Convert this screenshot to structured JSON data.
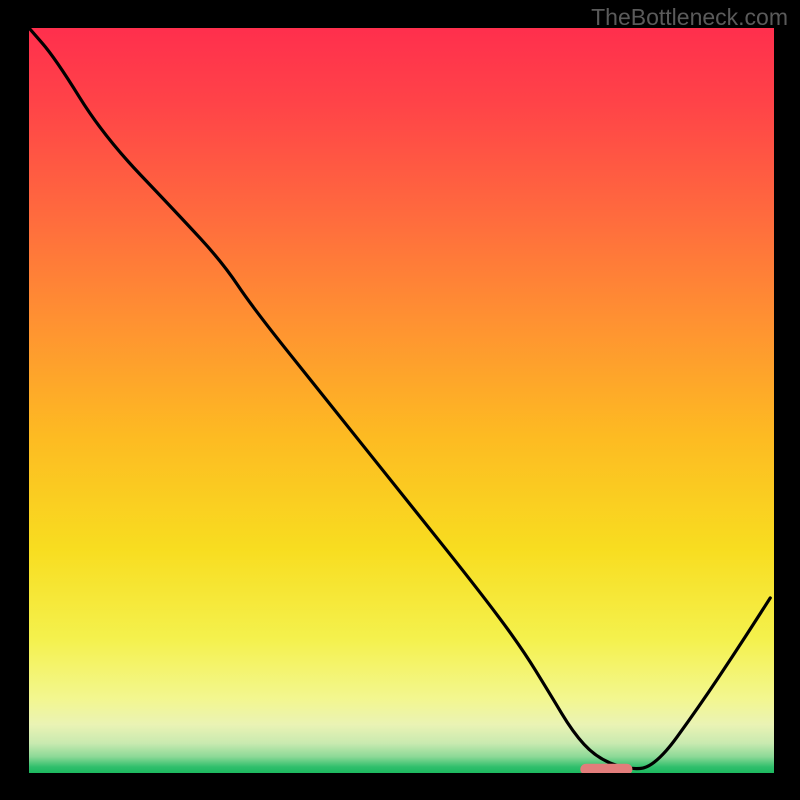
{
  "watermark": "TheBottleneck.com",
  "chart_data": {
    "type": "line",
    "title": "",
    "xlabel": "",
    "ylabel": "",
    "xlim": [
      0,
      100
    ],
    "ylim": [
      0,
      100
    ],
    "background_gradient": {
      "stops": [
        {
          "t": 0.0,
          "color": "#ff2f4d"
        },
        {
          "t": 0.1,
          "color": "#ff4348"
        },
        {
          "t": 0.25,
          "color": "#ff6a3e"
        },
        {
          "t": 0.4,
          "color": "#ff9331"
        },
        {
          "t": 0.55,
          "color": "#fdbb22"
        },
        {
          "t": 0.7,
          "color": "#f8dd20"
        },
        {
          "t": 0.82,
          "color": "#f4f14d"
        },
        {
          "t": 0.9,
          "color": "#f3f78f"
        },
        {
          "t": 0.935,
          "color": "#eaf3b4"
        },
        {
          "t": 0.96,
          "color": "#c9eab0"
        },
        {
          "t": 0.978,
          "color": "#8dd997"
        },
        {
          "t": 0.992,
          "color": "#2fbf6c"
        },
        {
          "t": 1.0,
          "color": "#1cb95f"
        }
      ]
    },
    "series": [
      {
        "name": "bottleneck-curve",
        "color": "#000000",
        "x": [
          0.0,
          3.5,
          10.0,
          20.0,
          26.0,
          30.0,
          40.0,
          50.0,
          60.0,
          66.0,
          70.0,
          73.0,
          76.0,
          80.0,
          84.0,
          90.0,
          95.0,
          99.5
        ],
        "y": [
          100.0,
          96.0,
          85.5,
          75.0,
          68.5,
          62.5,
          50.0,
          37.5,
          25.0,
          17.0,
          10.5,
          5.5,
          2.2,
          0.5,
          0.7,
          9.0,
          16.5,
          23.5
        ]
      }
    ],
    "marker": {
      "name": "result-marker",
      "color": "#e37d7b",
      "x_center": 77.5,
      "y_center": 0.5,
      "half_width": 3.5,
      "height": 1.5
    }
  }
}
